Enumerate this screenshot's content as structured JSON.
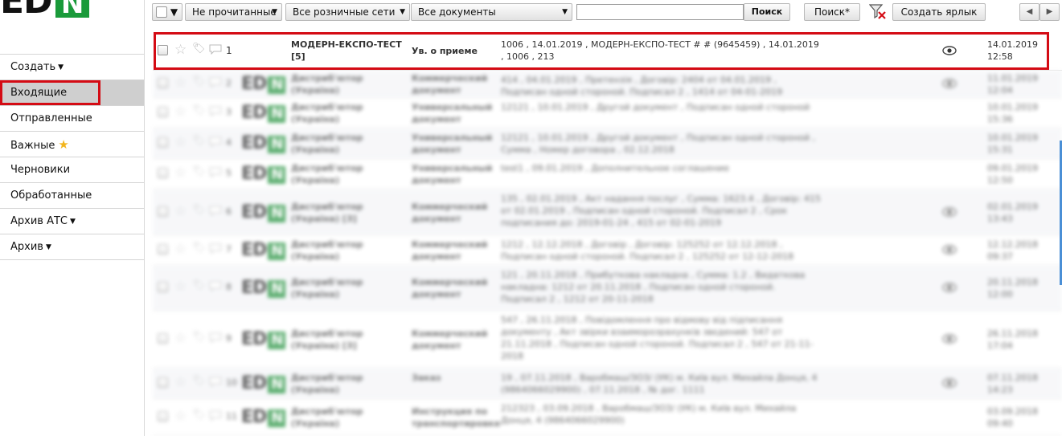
{
  "logo": {
    "text_left": "ED",
    "text_box": "N"
  },
  "sidebar": {
    "items": [
      {
        "label": "Создать",
        "chevron": true,
        "star": false
      },
      {
        "label": "Входящие",
        "chevron": false,
        "star": false,
        "active": true
      },
      {
        "label": "Отправленные",
        "chevron": false,
        "star": false
      },
      {
        "label": "Важные",
        "chevron": false,
        "star": true
      },
      {
        "label": "Черновики",
        "chevron": false,
        "star": false
      },
      {
        "label": "Обработанные",
        "chevron": false,
        "star": false
      },
      {
        "label": "Архив АТС",
        "chevron": true,
        "star": false
      },
      {
        "label": "Архив",
        "chevron": true,
        "star": false
      }
    ]
  },
  "toolbar": {
    "filter_unread": "Не прочитанные",
    "filter_network": "Все розничные сети",
    "filter_docs": "Все документы",
    "search_button": "Поиск",
    "advanced_search": "Поиск*",
    "create_label": "Создать ярлык",
    "search_value": ""
  },
  "colors": {
    "brand_green": "#1a9a3a",
    "highlight_red": "#d40b14",
    "active_bg": "#cfcfcf"
  },
  "messages": [
    {
      "num": "1",
      "sender": "МОДЕРН-ЕКСПО-ТЕСТ [5]",
      "doctype": "Ув. о приеме",
      "desc": "1006 , 14.01.2019 , МОДЕРН-ЕКСПО-ТЕСТ # # (9645459) , 14.01.2019 , 1006 , 213",
      "date": "14.01.2019 12:58",
      "eye": true,
      "logo": false
    },
    {
      "num": "2",
      "sender": "Дистриб'ютор (Україна)",
      "doctype": "Коммерческий документ",
      "desc": "414 , 04.01.2019 , Претензія , Договір: 2404 от 04.01.2019 , Подписан одной стороной. Подписал 2 , 1414 от 04-01-2019",
      "date": "11.01.2019 12:04",
      "eye": true,
      "logo": true
    },
    {
      "num": "3",
      "sender": "Дистриб'ютор (Україна)",
      "doctype": "Универсальный документ",
      "desc": "12121 , 10.01.2019 , Другой документ , Подписан одной стороной",
      "date": "10.01.2019 15:36",
      "eye": false,
      "logo": true
    },
    {
      "num": "4",
      "sender": "Дистриб'ютор (Україна)",
      "doctype": "Универсальный документ",
      "desc": "12121 , 10.01.2019 , Другой документ , Подписан одной стороной , Сумма , Номер договора , 02.12.2018",
      "date": "10.01.2019 15:31",
      "eye": false,
      "logo": true
    },
    {
      "num": "5",
      "sender": "Дистриб'ютор (Україна)",
      "doctype": "Универсальный документ",
      "desc": "test1 , 09.01.2019 , Дополнительное соглашение",
      "date": "09.01.2019 12:50",
      "eye": false,
      "logo": true
    },
    {
      "num": "6",
      "sender": "Дистриб'ютор (Україна) [3]",
      "doctype": "Коммерческий документ",
      "desc": "135 , 02.01.2019 , Акт надання послуг , Сумма: 1623.4 , Договір: 415 от 02.01.2019 , Подписан одной стороной. Подписал 2 , Срок подписания до: 2019-01-24 , 415 от 02-01-2019",
      "date": "02.01.2019 13:43",
      "eye": true,
      "logo": true
    },
    {
      "num": "7",
      "sender": "Дистриб'ютор (Україна)",
      "doctype": "Коммерческий документ",
      "desc": "1212 , 12.12.2018 , Договір , Договір: 125252 от 12.12.2018 , Подписан одной стороной. Подписал 2 , 125252 от 12-12-2018",
      "date": "12.12.2018 09:37",
      "eye": true,
      "logo": true
    },
    {
      "num": "8",
      "sender": "Дистриб'ютор (Україна)",
      "doctype": "Коммерческий документ",
      "desc": "121 , 20.11.2018 , Прибуткова накладна , Сумма: 1.2 , Видаткова накладна: 1212 от 20.11.2018 , Подписан одной стороной. Подписал 2 , 1212 от 20-11-2018",
      "date": "20.11.2018 12:00",
      "eye": true,
      "logo": true
    },
    {
      "num": "9",
      "sender": "Дистриб'ютор (Україна) [3]",
      "doctype": "Коммерческий документ",
      "desc": "547 , 26.11.2018 , Повідомлення про відмову від підписання документу , Акт звірки взаиморозрахунків звєдений: 547 от 21.11.2018 , Подписан одной стороной. Подписал 2 , 547 от 21-11-2018",
      "date": "26.11.2018 17:04",
      "eye": true,
      "logo": true
    },
    {
      "num": "10",
      "sender": "Дистриб'ютор (Україна)",
      "doctype": "Заказ",
      "desc": "19 , 07.11.2018 , Варобмаш/ЗОЗ/ (УК) м. Київ вул. Михайла Донця, 4 (9864066029900) , 07.11.2018 , № дог. 1111",
      "date": "07.11.2018 14:23",
      "eye": true,
      "logo": true
    },
    {
      "num": "11",
      "sender": "Дистриб'ютор (Україна)",
      "doctype": "Инструкция по транспортировке",
      "desc": "212323 , 03.09.2018 , Варобмаш/ЗОЗ/ (УК) м. Київ вул. Михайла Донця, 4 (9864066029900)",
      "date": "03.09.2018 09:40",
      "eye": false,
      "logo": true
    }
  ]
}
